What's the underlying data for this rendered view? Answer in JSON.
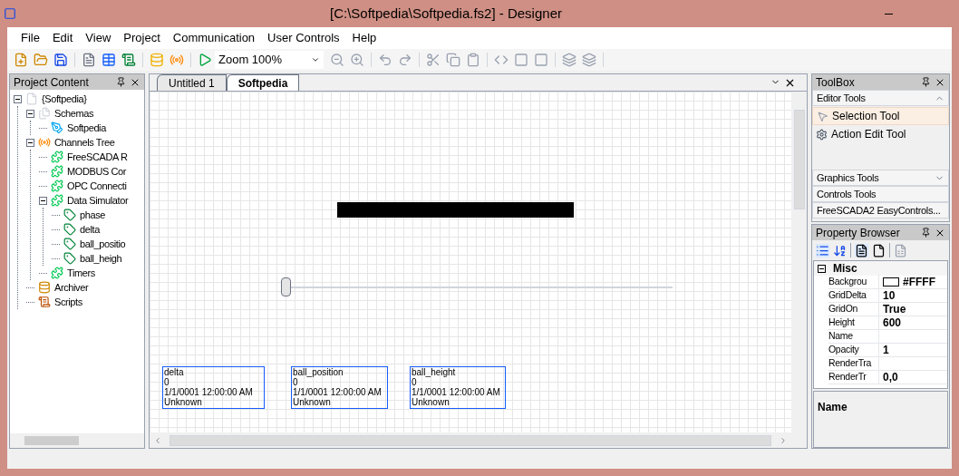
{
  "window": {
    "title": "[C:\\Softpedia\\Softpedia.fs2] - Designer"
  },
  "menu": [
    "File",
    "Edit",
    "View",
    "Project",
    "Communication",
    "User Controls",
    "Help"
  ],
  "toolbar": {
    "zoom": "Zoom 100%"
  },
  "project_panel": {
    "title": "Project Content",
    "tree": [
      {
        "label": "{Softpedia}",
        "kind": "document",
        "expanded": true,
        "children": [
          {
            "label": "Schemas",
            "kind": "folder",
            "expanded": true,
            "children": [
              {
                "label": "Softpedia",
                "kind": "schema"
              }
            ]
          },
          {
            "label": "Channels Tree",
            "kind": "antenna",
            "expanded": true,
            "children": [
              {
                "label": "FreeSCADA R",
                "kind": "plugin"
              },
              {
                "label": "MODBUS Cor",
                "kind": "plugin"
              },
              {
                "label": "OPC Connecti",
                "kind": "plugin"
              },
              {
                "label": "Data Simulator",
                "kind": "plugin",
                "expanded": true,
                "children": [
                  {
                    "label": "phase",
                    "kind": "tag"
                  },
                  {
                    "label": "delta",
                    "kind": "tag"
                  },
                  {
                    "label": "ball_positio",
                    "kind": "tag"
                  },
                  {
                    "label": "ball_heigh",
                    "kind": "tag"
                  }
                ]
              },
              {
                "label": "Timers",
                "kind": "plugin"
              }
            ]
          },
          {
            "label": "Archiver",
            "kind": "database"
          },
          {
            "label": "Scripts",
            "kind": "scroll"
          }
        ]
      }
    ]
  },
  "tabs": [
    {
      "label": "Untitled 1",
      "selected": false
    },
    {
      "label": "Softpedia",
      "selected": true
    }
  ],
  "canvas": {
    "slider": {
      "level": 0.0
    },
    "labels": [
      {
        "name": "delta",
        "value": "0",
        "time": "1/1/0001 12:00:00 AM",
        "status": "Unknown"
      },
      {
        "name": "ball_position",
        "value": "0",
        "time": "1/1/0001 12:00:00 AM",
        "status": "Unknown"
      },
      {
        "name": "ball_height",
        "value": "0",
        "time": "1/1/0001 12:00:00 AM",
        "status": "Unknown"
      }
    ]
  },
  "toolbox": {
    "title": "ToolBox",
    "groups": [
      {
        "label": "Editor Tools",
        "expanded": true,
        "items": [
          {
            "label": "Selection Tool",
            "kind": "pointer",
            "selected": true
          },
          {
            "label": "Action Edit Tool",
            "kind": "gear",
            "selected": false
          }
        ]
      },
      {
        "label": "Graphics Tools",
        "expanded": false
      },
      {
        "label": "Controls Tools",
        "expanded": false
      },
      {
        "label": "FreeSCADA2  EasyControls...",
        "expanded": false
      }
    ]
  },
  "property_browser": {
    "title": "Property Browser",
    "category": "Misc",
    "rows": [
      {
        "name": "Backgrou",
        "value": "#FFFF",
        "kind": "color"
      },
      {
        "name": "GridDelta",
        "value": "10",
        "kind": "text"
      },
      {
        "name": "GridOn",
        "value": "True",
        "kind": "text"
      },
      {
        "name": "Height",
        "value": "600",
        "kind": "text"
      },
      {
        "name": "Name",
        "kind": "text"
      },
      {
        "name": "Opacity",
        "value": "1",
        "kind": "text"
      },
      {
        "name": "RenderTra",
        "kind": "text"
      },
      {
        "name": "RenderTr",
        "value": "0,0",
        "kind": "text"
      }
    ],
    "description": "Name"
  }
}
